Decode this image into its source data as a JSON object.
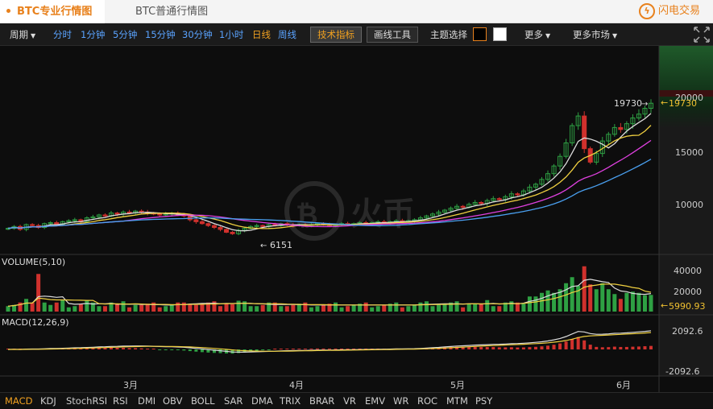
{
  "tabs": {
    "pro": "BTC专业行情图",
    "normal": "BTC普通行情图"
  },
  "brand": {
    "name": "闪电交易",
    "icon": "lightning-logo-icon"
  },
  "toolbar": {
    "period_label": "周期",
    "periods": [
      "分时",
      "1分钟",
      "5分钟",
      "15分钟",
      "30分钟",
      "1小时",
      "日线",
      "周线"
    ],
    "active_period": "日线",
    "tech_button": "技术指标",
    "draw_button": "画线工具",
    "theme_label": "主题选择",
    "more": "更多",
    "more_markets": "更多市场"
  },
  "watermark": "火币",
  "main_panel": {
    "price_ticks": [
      "20000",
      "15000",
      "10000"
    ],
    "high_label": "19730",
    "current_price": "19730",
    "low_label": "6151"
  },
  "volume_panel": {
    "title": "VOLUME(5,10)",
    "ticks": [
      "40000",
      "20000"
    ],
    "current": "5990.93"
  },
  "macd_panel": {
    "title": "MACD(12,26,9)",
    "ticks": [
      "2092.6",
      "-2092.6"
    ]
  },
  "x_labels": [
    "3月",
    "4月",
    "5月",
    "6月"
  ],
  "indicators": [
    "MACD",
    "KDJ",
    "StochRSI",
    "RSI",
    "DMI",
    "OBV",
    "BOLL",
    "SAR",
    "DMA",
    "TRIX",
    "BRAR",
    "VR",
    "EMV",
    "WR",
    "ROC",
    "MTM",
    "PSY"
  ],
  "active_indicator": "MACD",
  "colors": {
    "accent": "#e8811c",
    "up": "#2ea043",
    "down": "#d0312d",
    "ma_white": "#dcdcdc",
    "ma_yellow": "#f0d040",
    "ma_magenta": "#e040e0",
    "ma_blue": "#4aa0f0",
    "theme_dark": "#000000",
    "theme_light": "#ffffff"
  },
  "chart_data": {
    "type": "candlestick",
    "title": "BTC",
    "period": "日线",
    "x_axis_labels": [
      "3月",
      "4月",
      "5月",
      "6月"
    ],
    "price_axis": {
      "ticks": [
        20000,
        15000,
        10000
      ],
      "range": [
        5000,
        22000
      ]
    },
    "close_series": [
      6700,
      6900,
      6600,
      7100,
      7000,
      6800,
      7200,
      7300,
      7100,
      7400,
      7500,
      7600,
      7400,
      7800,
      7900,
      8100,
      8000,
      8300,
      8200,
      8400,
      8300,
      8500,
      8400,
      8300,
      8200,
      8100,
      8200,
      8300,
      8100,
      8000,
      7600,
      7400,
      7200,
      7000,
      6800,
      6600,
      6300,
      6151,
      6500,
      6700,
      6900,
      7000,
      6900,
      7100,
      7000,
      7200,
      7100,
      7000,
      7100,
      7000,
      7100,
      7200,
      7100,
      7000,
      7100,
      7200,
      7100,
      7200,
      7300,
      7200,
      7300,
      7400,
      7300,
      7400,
      7500,
      7400,
      7500,
      7600,
      7800,
      8000,
      8200,
      8400,
      8600,
      8800,
      9000,
      8900,
      9200,
      9400,
      9300,
      9600,
      9800,
      9700,
      10000,
      10300,
      10200,
      10600,
      11000,
      11300,
      11800,
      12400,
      13200,
      14200,
      15600,
      17400,
      18400,
      15000,
      13600,
      14500,
      15800,
      16500,
      17200,
      17000,
      17600,
      18200,
      18600,
      19200,
      19730
    ],
    "high": 19730,
    "low": 6151,
    "moving_averages": [
      "white",
      "yellow",
      "magenta",
      "blue"
    ],
    "volume": {
      "title": "VOLUME(5,10)",
      "current": 5990.93,
      "axis_ticks": [
        40000,
        20000
      ]
    },
    "macd": {
      "title": "MACD(12,26,9)",
      "axis_ticks": [
        2092.6,
        -2092.6
      ]
    }
  }
}
